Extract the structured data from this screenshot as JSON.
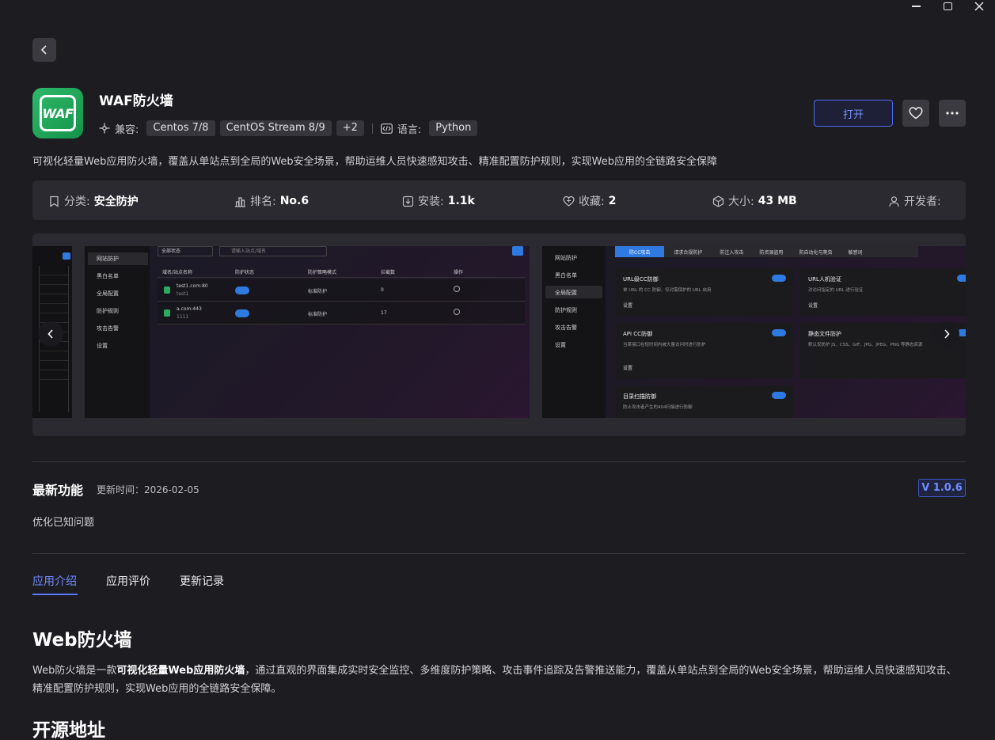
{
  "app": {
    "name": "WAF防火墙",
    "icon_text": "WAF",
    "compat_label": "兼容:",
    "compat": [
      "Centos 7/8",
      "CentOS Stream 8/9",
      "+2"
    ],
    "lang_label": "语言:",
    "lang": "Python",
    "description": "可视化轻量Web应用防火墙，覆盖从单站点到全局的Web安全场景，帮助运维人员快速感知攻击、精准配置防护规则，实现Web应用的全链路安全保障"
  },
  "actions": {
    "open": "打开"
  },
  "stats": [
    {
      "label": "分类:",
      "value": "安全防护",
      "icon": "category-icon"
    },
    {
      "label": "排名:",
      "value": "No.6",
      "icon": "rank-icon"
    },
    {
      "label": "安装:",
      "value": "1.1k",
      "icon": "install-icon"
    },
    {
      "label": "收藏:",
      "value": "2",
      "icon": "favorite-icon"
    },
    {
      "label": "大小:",
      "value": "43 MB",
      "icon": "size-icon"
    },
    {
      "label": "开发者:",
      "value": "",
      "icon": "developer-icon"
    }
  ],
  "screenshot1": {
    "menu": [
      "网站防护",
      "黑白名单",
      "全局配置",
      "防护规则",
      "攻击告警",
      "设置"
    ],
    "filter": "全部状态",
    "search_placeholder": "请输入站点/域名",
    "headers": [
      "域名/站点名称",
      "防护状态",
      "防护策略模式",
      "拦截数",
      "操作"
    ],
    "rows": [
      {
        "name": "test1.com:80",
        "sub": "test1",
        "mode": "标准防护",
        "count": "0"
      },
      {
        "name": "a.com:443",
        "sub": "1111",
        "mode": "标准防护",
        "count": "17"
      }
    ]
  },
  "screenshot2": {
    "menu": [
      "网站防护",
      "黑白名单",
      "全局配置",
      "防护规则",
      "攻击告警",
      "设置"
    ],
    "tabs": [
      "防CC攻击",
      "请求合规防护",
      "防注入攻击",
      "防资源盗用",
      "防自动化与爬虫",
      "敏感词"
    ],
    "cards": [
      {
        "title": "URL级CC防御",
        "desc": "单 URL 的 CC 防御，仅对需保护的 URL 启用",
        "link": "设置"
      },
      {
        "title": "URL人机验证",
        "desc": "对访问指定的 URL 进行验证",
        "link": "设置"
      },
      {
        "title": "API CC防御",
        "desc": "当某接口在短时间内被大量访问时进行防护",
        "link": "设置"
      },
      {
        "title": "静态文件防护",
        "desc": "默认仅防护 JS、CSS、GIF、JPG、JPEG、PNG 等静态资源",
        "link": ""
      },
      {
        "title": "目录扫描防御",
        "desc": "防止攻击者产生的404扫描进行防御",
        "link": ""
      }
    ]
  },
  "latest": {
    "title": "最新功能",
    "update_time": "更新时间：2026-02-05",
    "version": "V 1.0.6",
    "note": "优化已知问题"
  },
  "tabs": [
    "应用介绍",
    "应用评价",
    "更新记录"
  ],
  "intro": {
    "heading": "Web防火墙",
    "p_prefix": "Web防火墙是一款",
    "p_bold": "可视化轻量Web应用防火墙",
    "p_rest": "，通过直观的界面集成实时安全监控、多维度防护策略、攻击事件追踪及告警推送能力，覆盖从单站点到全局的Web安全场景，帮助运维人员快速感知攻击、精准配置防护规则，实现Web应用的全链路安全保障。",
    "heading2": "开源地址"
  }
}
